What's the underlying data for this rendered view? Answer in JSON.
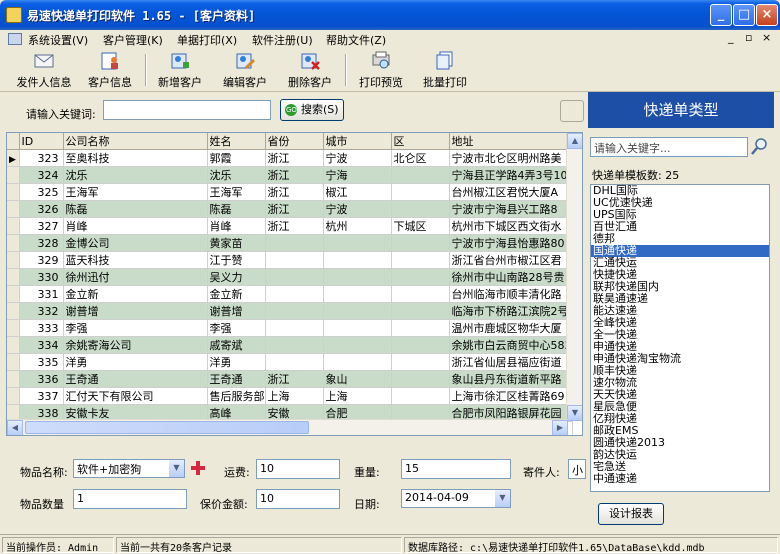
{
  "window": {
    "title": "易速快递单打印软件 1.65 - [客户资料]",
    "minimize": "_",
    "maximize": "□",
    "close": "×"
  },
  "menu": {
    "items": [
      "系统设置(V)",
      "客户管理(K)",
      "单据打印(X)",
      "软件注册(U)",
      "帮助文件(Z)"
    ],
    "mdi_controls": [
      "_",
      "▫",
      "×"
    ]
  },
  "toolbar": {
    "buttons": [
      {
        "label": "发件人信息",
        "icon": "envelope-icon"
      },
      {
        "label": "客户信息",
        "icon": "person-list-icon"
      },
      {
        "label": "新增客户",
        "icon": "add-person-icon"
      },
      {
        "label": "编辑客户",
        "icon": "edit-person-icon"
      },
      {
        "label": "删除客户",
        "icon": "delete-person-icon"
      },
      {
        "label": "打印预览",
        "icon": "print-preview-icon"
      },
      {
        "label": "批量打印",
        "icon": "batch-print-icon"
      }
    ]
  },
  "search": {
    "label": "请输入关键词:",
    "value": "",
    "button": "搜索(S)"
  },
  "grid": {
    "columns": [
      "ID",
      "公司名称",
      "姓名",
      "省份",
      "城市",
      "区",
      "地址"
    ],
    "rows": [
      [
        "323",
        "至奥科技",
        "郭霞",
        "浙江",
        "宁波",
        "北仑区",
        "宁波市北仑区明州路美"
      ],
      [
        "324",
        "沈乐",
        "沈乐",
        "浙江",
        "宁海",
        "",
        "宁海县正学路4弄3号10"
      ],
      [
        "325",
        "王海军",
        "王海军",
        "浙江",
        "椒江",
        "",
        "台州椒江区君悦大厦A"
      ],
      [
        "326",
        "陈磊",
        "陈磊",
        "浙江",
        "宁波",
        "",
        "宁波市宁海县兴工路8"
      ],
      [
        "327",
        "肖峰",
        "肖峰",
        "浙江",
        "杭州",
        "下城区",
        "杭州市下城区西文街水"
      ],
      [
        "328",
        "金博公司",
        "黄家苗",
        "",
        "",
        "",
        "宁波市宁海县怡惠路80"
      ],
      [
        "329",
        "蓝天科技",
        "江于赞",
        "",
        "",
        "",
        "浙江省台州市椒江区君"
      ],
      [
        "330",
        "徐州迅付",
        "吴义力",
        "",
        "",
        "",
        "徐州市中山南路28号贵"
      ],
      [
        "331",
        "金立新",
        "金立新",
        "",
        "",
        "",
        "台州临海市顺丰清化路"
      ],
      [
        "332",
        "谢普增",
        "谢普增",
        "",
        "",
        "",
        "临海市下桥路江滨院2号"
      ],
      [
        "333",
        "李强",
        "李强",
        "",
        "",
        "",
        "温州市鹿城区物华大厦"
      ],
      [
        "334",
        "余姚寄海公司",
        "戚寄斌",
        "",
        "",
        "",
        "余姚市白云商贸中心583"
      ],
      [
        "335",
        "洋勇",
        "洋勇",
        "",
        "",
        "",
        "浙江省仙居县福应街道"
      ],
      [
        "336",
        "王奇通",
        "王奇通",
        "浙江",
        "象山",
        "",
        "象山县丹东街道新平路"
      ],
      [
        "337",
        "汇付天下有限公司",
        "售后服务部",
        "上海",
        "上海",
        "",
        "上海市徐汇区桂菁路69"
      ],
      [
        "338",
        "安徽卡友",
        "高峰",
        "安徽",
        "合肥",
        "",
        "合肥市凤阳路银屏花园"
      ],
      [
        "339",
        "汇付天下有限公司，",
        "陆雅锥",
        "上海",
        "上海",
        "",
        "上海市虹梅路1801号部"
      ]
    ]
  },
  "right_panel": {
    "header": "快递单类型",
    "search_placeholder": "请输入关键字...",
    "template_count_label": "快递单模板数: 25",
    "items": [
      "DHL国际",
      "UC优速快递",
      "UPS国际",
      "百世汇通",
      "德邦",
      "国通快递",
      "汇通快运",
      "快捷快递",
      "联邦快递国内",
      "联昊通速递",
      "能达速递",
      "全峰快递",
      "全一快递",
      "申通快递",
      "申通快递淘宝物流",
      "顺丰快递",
      "速尔物流",
      "天天快递",
      "星辰急便",
      "亿翔快递",
      "邮政EMS",
      "圆通快递2013",
      "韵达快运",
      "宅急送",
      "中通速递"
    ],
    "selected_index": 5,
    "design_button": "设计报表"
  },
  "form": {
    "item_name_label": "物品名称:",
    "item_name_value": "软件+加密狗",
    "freight_label": "运费:",
    "freight_value": "10",
    "weight_label": "重量:",
    "weight_value": "15",
    "sender_label": "寄件人:",
    "sender_value": "小",
    "quantity_label": "物品数量",
    "quantity_value": "1",
    "insured_label": "保价金额:",
    "insured_value": "10",
    "date_label": "日期:",
    "date_value": "2014-04-09"
  },
  "status": {
    "operator": "当前操作员: Admin",
    "count": "当前一共有20条客户记录",
    "db_path": "数据库路径: c:\\易速快递单打印软件1.65\\DataBase\\kdd.mdb"
  },
  "colors": {
    "title_blue": "#0454d6",
    "row_alt": "#c9dcc9",
    "panel_header": "#1e4fa6",
    "selection": "#316ac5"
  }
}
